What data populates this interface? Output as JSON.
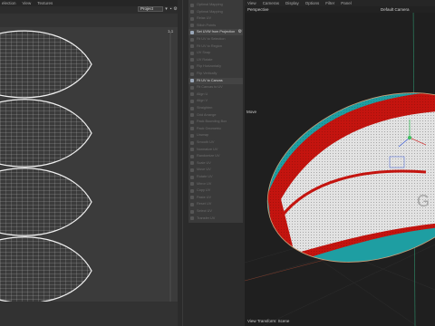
{
  "uv_editor": {
    "menu": [
      "election",
      "View",
      "Textures"
    ],
    "mode_select": "Project",
    "ruler_corner": "1,1"
  },
  "tool_panel": {
    "items": [
      {
        "label": "Optimal Mapping",
        "state": "inactive"
      },
      {
        "label": "Optimal Mapping",
        "state": "inactive"
      },
      {
        "label": "Relax UV",
        "state": "inactive"
      },
      {
        "label": "Stitch Points",
        "state": "inactive"
      },
      {
        "label": "Set UVW from Projection",
        "state": "active"
      },
      {
        "label": "Fit UV to Selection",
        "state": "inactive"
      },
      {
        "label": "Fit UV to Region",
        "state": "inactive"
      },
      {
        "label": "UV Snap",
        "state": "inactive"
      },
      {
        "label": "UV Rotate",
        "state": "inactive"
      },
      {
        "label": "Flip Horizontally",
        "state": "inactive"
      },
      {
        "label": "Flip Vertically",
        "state": "inactive"
      },
      {
        "label": "Fit UV to Canvas",
        "state": "active"
      },
      {
        "label": "Fit Canvas to UV",
        "state": "inactive"
      },
      {
        "label": "Align U",
        "state": "inactive"
      },
      {
        "label": "Align V",
        "state": "inactive"
      },
      {
        "label": "Straighten",
        "state": "inactive"
      },
      {
        "label": "Grid Arrange",
        "state": "inactive"
      },
      {
        "label": "Pack Bounding Box",
        "state": "inactive"
      },
      {
        "label": "Pack Geometric",
        "state": "inactive"
      },
      {
        "label": "Unwrap",
        "state": "inactive"
      },
      {
        "label": "Smooth UV",
        "state": "inactive"
      },
      {
        "label": "Normalize UV",
        "state": "inactive"
      },
      {
        "label": "Randomize UV",
        "state": "inactive"
      },
      {
        "label": "Scale UV",
        "state": "inactive"
      },
      {
        "label": "Move UV",
        "state": "inactive"
      },
      {
        "label": "Rotate UV",
        "state": "inactive"
      },
      {
        "label": "Mirror UV",
        "state": "inactive"
      },
      {
        "label": "Copy UV",
        "state": "inactive"
      },
      {
        "label": "Paste UV",
        "state": "inactive"
      },
      {
        "label": "Reset UV",
        "state": "inactive"
      },
      {
        "label": "Select UV",
        "state": "inactive"
      },
      {
        "label": "Transfer UV",
        "state": "inactive"
      }
    ]
  },
  "viewport": {
    "menu": [
      "View",
      "Cameras",
      "Display",
      "Options",
      "Filter",
      "Panel"
    ],
    "label": "Perspective",
    "camera": "Default Camera",
    "move_label": "Move",
    "status": "View Transform: Scene"
  },
  "colors": {
    "ball_red": "#c4140f",
    "ball_teal": "#1e9ea2",
    "ball_white": "#e2e2e2",
    "uv_wire": "#e9e9e9",
    "uv_bg": "#3b3b3b"
  }
}
